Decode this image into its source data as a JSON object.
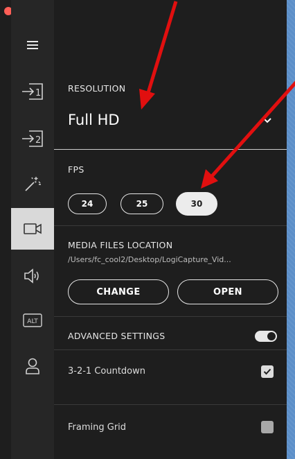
{
  "colors": {
    "background": "#5c8fc9",
    "window": "#1e1e1e",
    "sidebar": "#262626",
    "sidebar_active": "#d9d9d9",
    "annotation_arrow": "#e10f0f",
    "traffic_close": "#ff5f57",
    "traffic_minimize": "#febc2e",
    "traffic_zoom": "#28c840"
  },
  "window_controls": [
    "close",
    "minimize",
    "zoom"
  ],
  "sidebar": {
    "items": [
      {
        "icon": "menu-icon"
      },
      {
        "icon": "source-1-icon",
        "label": "1"
      },
      {
        "icon": "source-2-icon",
        "label": "2"
      },
      {
        "icon": "magic-wand-icon"
      },
      {
        "icon": "camera-icon",
        "active": true
      },
      {
        "icon": "speaker-icon"
      },
      {
        "icon": "alt-icon",
        "label": "ALT"
      },
      {
        "icon": "user-icon"
      }
    ]
  },
  "resolution": {
    "label": "RESOLUTION",
    "value": "Full HD"
  },
  "fps": {
    "label": "FPS",
    "options": [
      "24",
      "25",
      "30"
    ],
    "selected": "30"
  },
  "media": {
    "label": "MEDIA FILES LOCATION",
    "path": "/Users/fc_cool2/Desktop/LogiCapture_Vid...",
    "change_label": "CHANGE",
    "open_label": "OPEN"
  },
  "advanced": {
    "label": "ADVANCED SETTINGS",
    "enabled": true
  },
  "countdown": {
    "label": "3-2-1 Countdown",
    "checked": true
  },
  "framing_grid": {
    "label": "Framing Grid",
    "checked": false
  },
  "annotations": [
    "arrow-to-resolution",
    "arrow-to-fps"
  ]
}
